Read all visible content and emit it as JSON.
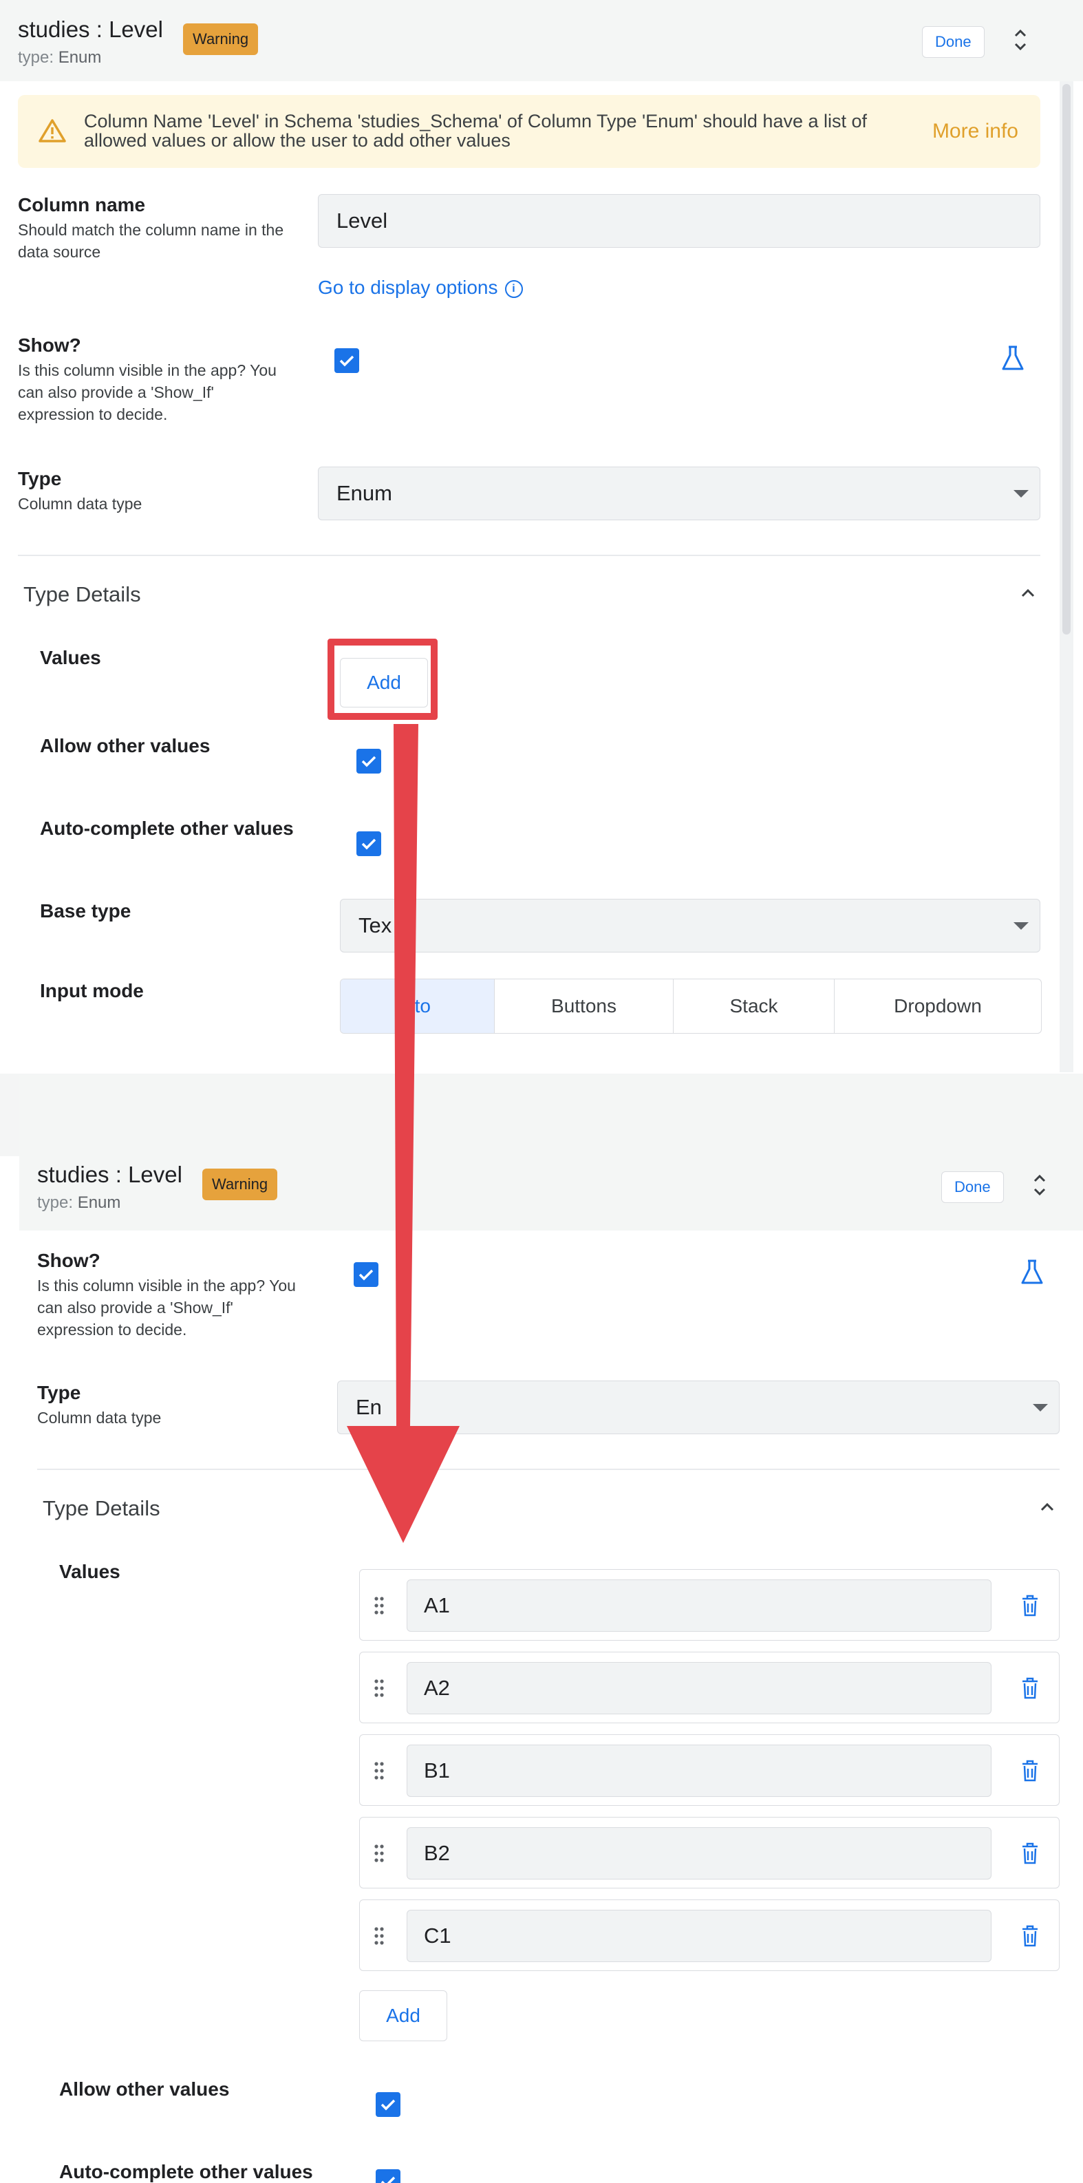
{
  "top": {
    "header": {
      "title": "studies : Level",
      "type_prefix": "type:",
      "type_value": "Enum",
      "badge": "Warning",
      "done": "Done"
    },
    "banner": {
      "message": "Column Name 'Level' in Schema 'studies_Schema' of Column Type 'Enum' should have a list of allowed values or allow the user to add other values",
      "more_info": "More info"
    },
    "column_name": {
      "label": "Column name",
      "help": "Should match the column name in the data source",
      "value": "Level",
      "display_link": "Go to display options"
    },
    "show": {
      "label": "Show?",
      "help": "Is this column visible in the app? You can also provide a 'Show_If' expression to decide."
    },
    "type": {
      "label": "Type",
      "help": "Column data type",
      "value": "Enum"
    },
    "type_details": {
      "title": "Type Details",
      "values_label": "Values",
      "add": "Add",
      "allow_other": "Allow other values",
      "autocomplete": "Auto-complete other values",
      "base_type_label": "Base type",
      "base_type_value": "Tex",
      "input_mode_label": "Input mode",
      "input_modes": [
        "uto",
        "Buttons",
        "Stack",
        "Dropdown"
      ]
    }
  },
  "bottom": {
    "header": {
      "title": "studies : Level",
      "type_prefix": "type:",
      "type_value": "Enum",
      "badge": "Warning",
      "done": "Done"
    },
    "show": {
      "label": "Show?",
      "help": "Is this column visible in the app? You can also provide a 'Show_If' expression to decide."
    },
    "type": {
      "label": "Type",
      "help": "Column data type",
      "value": "En"
    },
    "type_details": {
      "title": "Type Details",
      "values_label": "Values",
      "values": [
        "A1",
        "A2",
        "B1",
        "B2",
        "C1"
      ],
      "add": "Add",
      "allow_other": "Allow other values",
      "autocomplete": "Auto-complete other values"
    }
  },
  "colors": {
    "accent": "#1a73e8",
    "warning": "#e6a23c",
    "annotation": "#e5434a"
  }
}
